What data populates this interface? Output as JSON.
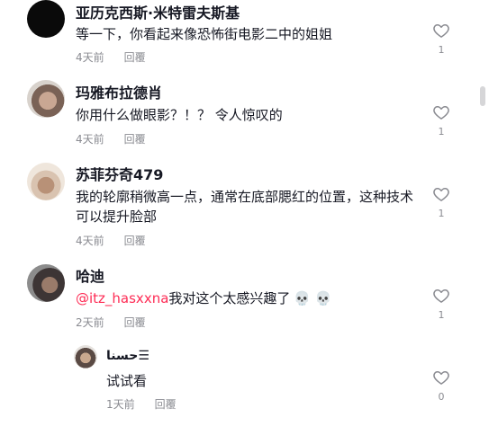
{
  "comments": [
    {
      "username": "亚历克西斯·米特雷夫斯基",
      "text": "等一下，你看起来像恐怖街电影二中的姐姐",
      "time": "4天前",
      "reply": "回覆",
      "likes": "1"
    },
    {
      "username": "玛雅布拉德肖",
      "text": "你用什么做眼影？！？ 令人惊叹的",
      "time": "4天前",
      "reply": "回覆",
      "likes": "1"
    },
    {
      "username": "苏菲芬奇479",
      "text": "我的轮廓稍微高一点，通常在底部腮红的位置，这种技术可以提升脸部",
      "time": "4天前",
      "reply": "回覆",
      "likes": "1"
    },
    {
      "username": "哈迪",
      "mention": "@itz_hasxxna",
      "text": "我对这个太感兴趣了",
      "emoji": "💀 💀",
      "time": "2天前",
      "reply": "回覆",
      "likes": "1"
    }
  ],
  "reply_comment": {
    "username": "حسنا☰",
    "text": "试试看",
    "time": "1天前",
    "reply": "回覆",
    "likes": "0"
  },
  "colors": {
    "mention": "#fe2c55",
    "meta": "#8a8b91",
    "text": "#161823"
  },
  "icons": {
    "like": "heart-outline-icon",
    "skull": "skull-emoji"
  }
}
